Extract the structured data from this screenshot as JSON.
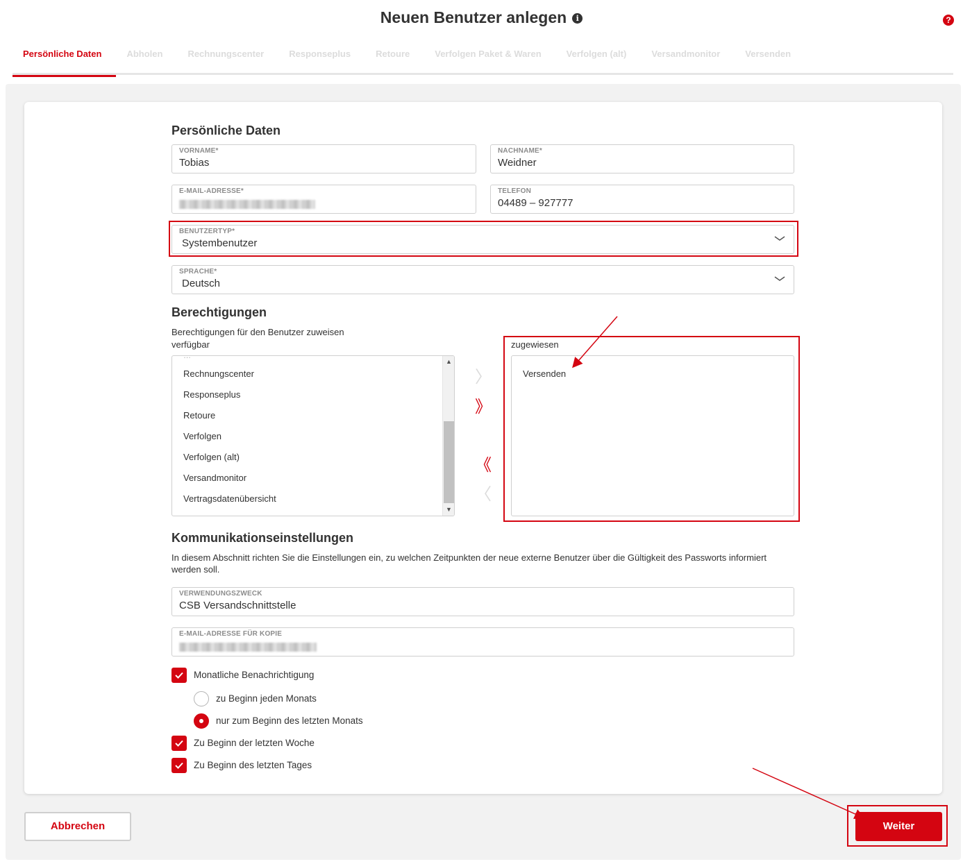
{
  "header": {
    "title": "Neuen Benutzer anlegen",
    "info_icon": "info-icon",
    "help_icon": "help-icon",
    "help_glyph": "?",
    "info_glyph": "i"
  },
  "tabs": [
    {
      "label": "Persönliche Daten",
      "active": true
    },
    {
      "label": "Abholen",
      "active": false
    },
    {
      "label": "Rechnungscenter",
      "active": false
    },
    {
      "label": "Responseplus",
      "active": false
    },
    {
      "label": "Retoure",
      "active": false
    },
    {
      "label": "Verfolgen Paket & Waren",
      "active": false
    },
    {
      "label": "Verfolgen (alt)",
      "active": false
    },
    {
      "label": "Versandmonitor",
      "active": false
    },
    {
      "label": "Versenden",
      "active": false
    }
  ],
  "personal": {
    "title": "Persönliche Daten",
    "first_name": {
      "label": "VORNAME*",
      "value": "Tobias"
    },
    "last_name": {
      "label": "NACHNAME*",
      "value": "Weidner"
    },
    "email": {
      "label": "E-MAIL-ADRESSE*"
    },
    "phone": {
      "label": "TELEFON",
      "value": "04489 – 927777"
    },
    "user_type": {
      "label": "BENUTZERTYP*",
      "value": "Systembenutzer"
    },
    "language": {
      "label": "SPRACHE*",
      "value": "Deutsch"
    }
  },
  "permissions": {
    "title": "Berechtigungen",
    "description": "Berechtigungen für den Benutzer zuweisen",
    "available_label": "verfügbar",
    "assigned_label": "zugewiesen",
    "available": [
      "Rechnungscenter",
      "Responseplus",
      "Retoure",
      "Verfolgen",
      "Verfolgen (alt)",
      "Versandmonitor",
      "Vertragsdatenübersicht"
    ],
    "assigned": [
      "Versenden"
    ],
    "buttons": {
      "add_one": "〉",
      "add_all": "》",
      "remove_all": "《",
      "remove_one": "〈"
    }
  },
  "communication": {
    "title": "Kommunikationseinstellungen",
    "description": "In diesem Abschnitt richten Sie die Einstellungen ein, zu welchen Zeitpunkten der neue externe Benutzer über die Gültigkeit des Passworts informiert werden soll.",
    "purpose": {
      "label": "VERWENDUNGSZWECK",
      "value": "CSB Versandschnittstelle"
    },
    "copy_email": {
      "label": "E-MAIL-ADRESSE FÜR KOPIE"
    },
    "monthly": {
      "label": "Monatliche Benachrichtigung",
      "checked": true
    },
    "radio_each_month": {
      "label": "zu Beginn jeden Monats",
      "checked": false
    },
    "radio_last_month": {
      "label": "nur zum Beginn des letzten Monats",
      "checked": true
    },
    "last_week": {
      "label": "Zu Beginn der letzten Woche",
      "checked": true
    },
    "last_day": {
      "label": "Zu Beginn des letzten Tages",
      "checked": true
    }
  },
  "footer": {
    "cancel_label": "Abbrechen",
    "next_label": "Weiter"
  },
  "colors": {
    "accent": "#d40511",
    "text": "#323232",
    "muted": "#dcdcdc"
  }
}
